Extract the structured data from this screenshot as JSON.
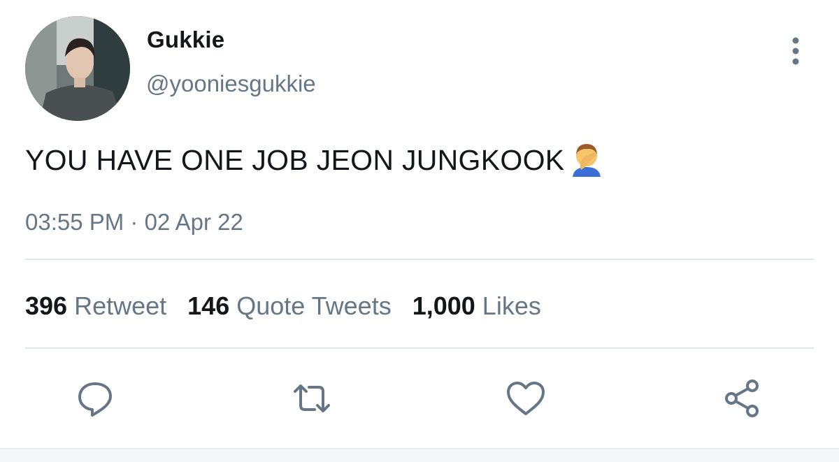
{
  "tweet": {
    "display_name": "Gukkie",
    "handle": "@yooniesgukkie",
    "text": "YOU HAVE ONE JOB JEON JUNGKOOK",
    "emoji_icon": "person-facepalming-icon",
    "time": "03:55 PM",
    "separator": "·",
    "date": "02 Apr 22"
  },
  "stats": {
    "retweets_count": "396",
    "retweets_label": "Retweet",
    "quotes_count": "146",
    "quotes_label": "Quote Tweets",
    "likes_count": "1,000",
    "likes_label": "Likes"
  },
  "actions": [
    "reply-icon",
    "retweet-icon",
    "like-icon",
    "share-icon"
  ],
  "colors": {
    "text_primary": "#14171a",
    "text_secondary": "#657786",
    "divider": "#e1e8ed",
    "icon": "#657786"
  }
}
